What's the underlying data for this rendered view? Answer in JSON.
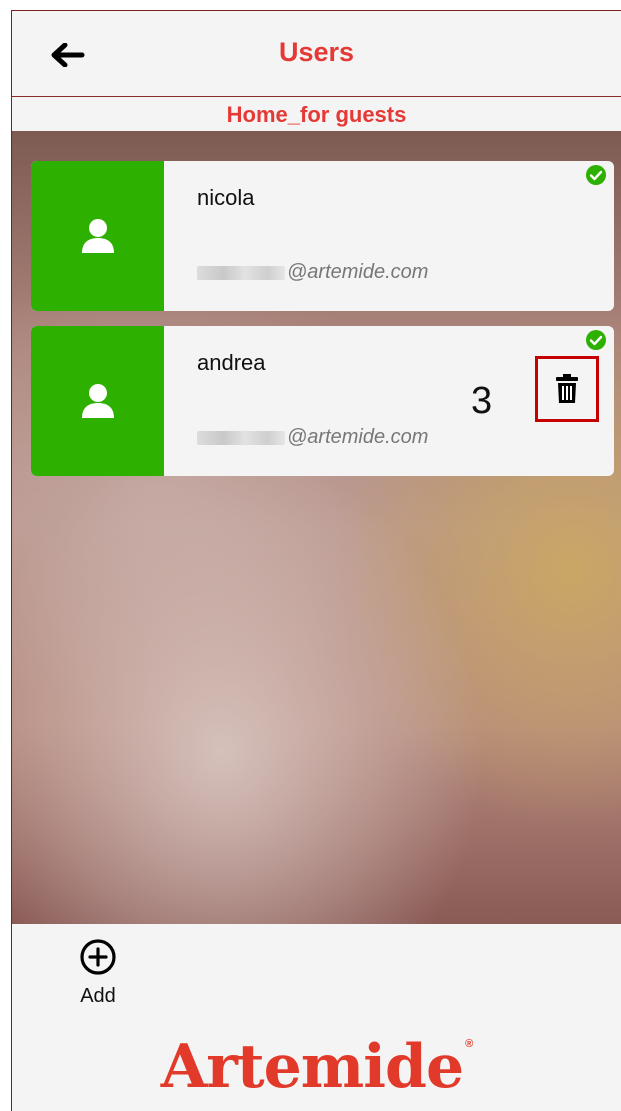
{
  "header": {
    "title": "Users",
    "back_icon": "arrow-left-icon"
  },
  "subheader": {
    "home_name": "Home_for guests"
  },
  "users": [
    {
      "name": "nicola",
      "email_domain": "@artemide.com",
      "status_icon": "check-circle-icon"
    },
    {
      "name": "andrea",
      "email_domain": "@artemide.com",
      "status_icon": "check-circle-icon"
    }
  ],
  "selection": {
    "count": "3",
    "delete_icon": "trash-icon"
  },
  "footer": {
    "add_label": "Add",
    "add_icon": "plus-circle-icon",
    "logo_text": "Artemide",
    "logo_mark": "®"
  },
  "colors": {
    "accent_red": "#e53935",
    "avatar_green": "#2db000",
    "status_green": "#2db000",
    "highlight_border": "#c40000"
  }
}
